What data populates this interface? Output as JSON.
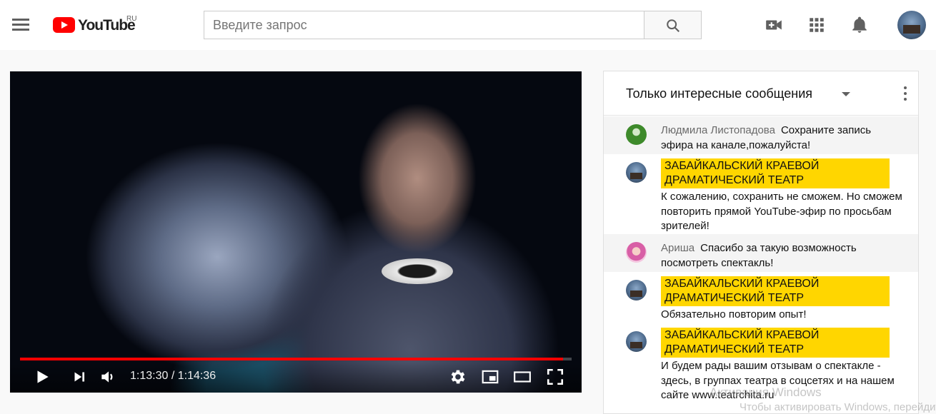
{
  "masthead": {
    "logo_text": "YouTube",
    "country_code": "RU",
    "search_placeholder": "Введите запрос",
    "icons": [
      "menu-icon",
      "search-icon",
      "create-video-icon",
      "apps-grid-icon",
      "notifications-bell-icon",
      "account-avatar"
    ]
  },
  "player": {
    "time_current": "1:13:30",
    "time_total": "1:14:36",
    "time_display": "1:13:30 / 1:14:36",
    "progress_fraction": 0.985,
    "progress_color": "#ff0000",
    "controls": [
      "play-icon",
      "next-icon",
      "volume-icon",
      "settings-gear-icon",
      "miniplayer-icon",
      "theater-mode-icon",
      "fullscreen-icon"
    ]
  },
  "chat": {
    "header_title": "Только интересные сообщения",
    "messages": [
      {
        "author": "Людмила Листопадова",
        "text": "Сохраните запись эфира на канале,пожалуйста!",
        "owner": false
      },
      {
        "author": "ЗАБАЙКАЛЬСКИЙ КРАЕВОЙ ДРАМАТИЧЕСКИЙ ТЕАТР",
        "text": "К сожалению, сохранить не сможем. Но сможем повторить прямой YouTube-эфир по просьбам зрителей!",
        "owner": true
      },
      {
        "author": "Ариша",
        "text": "Спасибо за такую возможность посмотреть спектакль!",
        "owner": false
      },
      {
        "author": "ЗАБАЙКАЛЬСКИЙ КРАЕВОЙ ДРАМАТИЧЕСКИЙ ТЕАТР",
        "text": "Обязательно повторим опыт!",
        "owner": true
      },
      {
        "author": "ЗАБАЙКАЛЬСКИЙ КРАЕВОЙ ДРАМАТИЧЕСКИЙ ТЕАТР",
        "text": "И будем рады вашим отзывам о спектакле - здесь, в группах театра в соцсетях и на нашем сайте www.teatrchita.ru",
        "owner": true
      }
    ],
    "owner_badge_color": "#ffd600"
  },
  "overlay": {
    "activation_line1": "Активация Windows",
    "activation_line2": "Чтобы активировать Windows, перейдите к"
  }
}
